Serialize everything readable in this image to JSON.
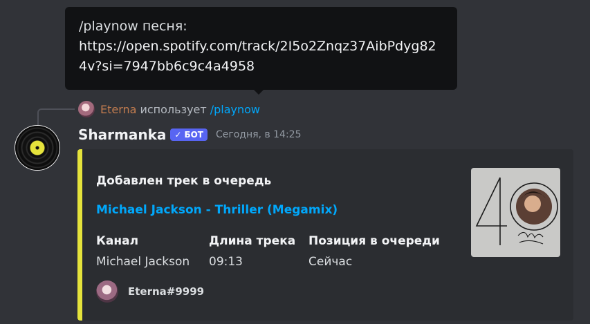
{
  "tooltip": {
    "line1": "/playnow песня:",
    "line2": "https://open.spotify.com/track/2I5o2Znqz37AibPdyg824v?si=7947bb6c9c4a4958"
  },
  "reply": {
    "user": "Eterna",
    "uses": "использует",
    "command": "/playnow"
  },
  "message": {
    "author": "Sharmanka",
    "badge": "БОТ",
    "timestamp": "Сегодня, в 14:25"
  },
  "embed": {
    "title": "Добавлен трек в очередь",
    "link": "Michael Jackson - Thriller (Megamix)",
    "fields": [
      {
        "name": "Канал",
        "value": "Michael Jackson"
      },
      {
        "name": "Длина трека",
        "value": "09:13"
      },
      {
        "name": "Позиция в очереди",
        "value": "Сейчас"
      }
    ],
    "footer": "Eterna#9999",
    "accent_color": "#e5e33c"
  },
  "colors": {
    "background": "#313338",
    "embed_bg": "#2b2d31",
    "link": "#00a8fc",
    "badge": "#5865f2"
  }
}
